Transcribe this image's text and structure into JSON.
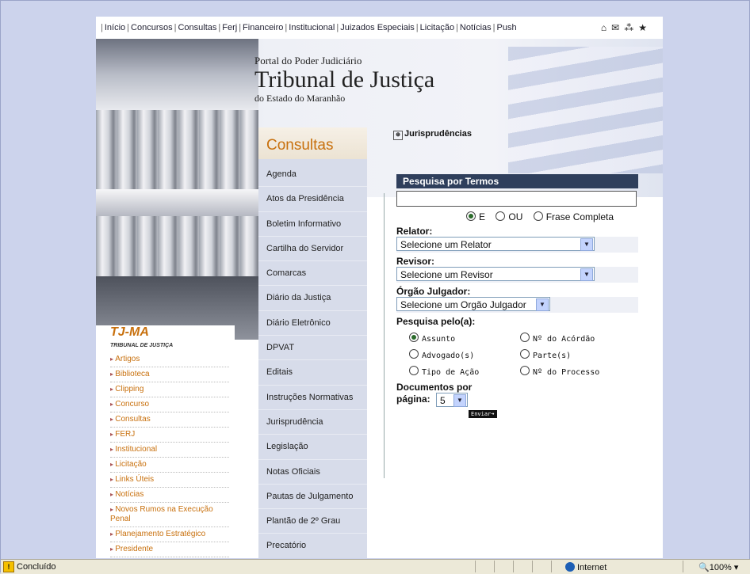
{
  "topnav": {
    "links": [
      "Início",
      "Concursos",
      "Consultas",
      "Ferj",
      "Financeiro",
      "Institucional",
      "Juizados Especiais",
      "Licitação",
      "Notícias",
      "Push"
    ],
    "icons": [
      "home-icon",
      "mail-icon",
      "sitemap-icon",
      "star-icon"
    ]
  },
  "brand": {
    "line1": "Portal do Poder Judiciário",
    "line2": "Tribunal de Justiça",
    "line3": "do Estado do Maranhão"
  },
  "sidebar": {
    "title": "TJ-MA",
    "subtitle": "TRIBUNAL DE JUSTIÇA",
    "items": [
      "Artigos",
      "Biblioteca",
      "Clipping",
      "Concurso",
      "Consultas",
      "FERJ",
      "Institucional",
      "Licitação",
      "Links Úteis",
      "Notícias",
      "Novos Rumos na Execução Penal",
      "Planejamento Estratégico",
      "Presidente"
    ]
  },
  "consultas": {
    "title": "Consultas",
    "items": [
      "Agenda",
      "Atos da Presidência",
      "Boletim Informativo",
      "Cartilha do Servidor",
      "Comarcas",
      "Diário da Justiça",
      "Diário Eletrônico",
      "DPVAT",
      "Editais",
      "Instruções Normativas",
      "Jurisprudência",
      "Legislação",
      "Notas Oficiais",
      "Pautas de Julgamento",
      "Plantão de 2º Grau",
      "Precatório"
    ]
  },
  "content": {
    "section": "Jurisprudências"
  },
  "form": {
    "panel_title": "Pesquisa por Termos",
    "search_value": "",
    "match_options": [
      "E",
      "OU",
      "Frase Completa"
    ],
    "match_selected": "E",
    "relator_label": "Relator:",
    "relator_value": "Selecione um Relator",
    "revisor_label": "Revisor:",
    "revisor_value": "Selecione um Revisor",
    "orgao_label": "Órgão Julgador:",
    "orgao_value": "Selecione um Orgão Julgador",
    "pesquisa_label": "Pesquisa pelo(a):",
    "pesquisa_options": [
      "Assunto",
      "Nº do Acórdão",
      "Advogado(s)",
      "Parte(s)",
      "Tipo de Ação",
      "Nº do Processo"
    ],
    "pesquisa_selected": "Assunto",
    "docs_label1": "Documentos por",
    "docs_label2": "página:",
    "docs_value": "5",
    "submit_label": "Enviar"
  },
  "statusbar": {
    "status": "Concluído",
    "zone": "Internet",
    "zoom": "100%"
  }
}
